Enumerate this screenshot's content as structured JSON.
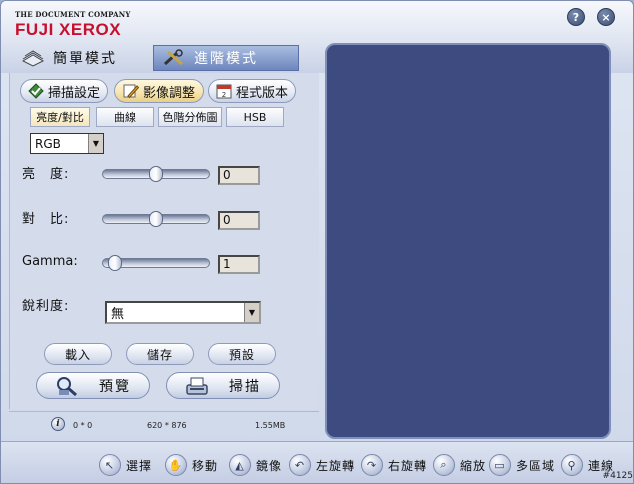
{
  "header": {
    "logo_top": "THE DOCUMENT COMPANY",
    "logo_main": "FUJI XEROX",
    "help_label": "?",
    "close_label": "×"
  },
  "modes": {
    "simple": "簡單模式",
    "advanced": "進階模式"
  },
  "main_tabs": {
    "scan_settings": "掃描設定",
    "image_adjust": "影像調整",
    "version": "程式版本"
  },
  "sub_tabs": {
    "brightness_contrast": "亮度/對比",
    "curve": "曲線",
    "histogram": "色階分佈圖",
    "hsb": "HSB"
  },
  "color_mode": {
    "selected": "RGB"
  },
  "adjustments": {
    "brightness": {
      "label": "亮　度:",
      "value": "0",
      "level": 0.5
    },
    "contrast": {
      "label": "對　比:",
      "value": "0",
      "level": 0.5
    },
    "gamma": {
      "label": "Gamma:",
      "value": "1",
      "level": 0.05
    }
  },
  "sharpness": {
    "label": "銳利度:",
    "selected": "無"
  },
  "buttons": {
    "load": "載入",
    "save": "儲存",
    "default": "預設",
    "preview": "預覽",
    "scan": "掃描"
  },
  "status": {
    "info_icon": "i",
    "position": "0 * 0",
    "dimensions": "620 * 876",
    "size": "1.55MB"
  },
  "toolbar": {
    "select": "選擇",
    "move": "移動",
    "mirror": "鏡像",
    "rotate_left": "左旋轉",
    "rotate_right": "右旋轉",
    "zoom": "縮放",
    "multi_area": "多區域",
    "link": "連線"
  },
  "version_tag": "#4125"
}
